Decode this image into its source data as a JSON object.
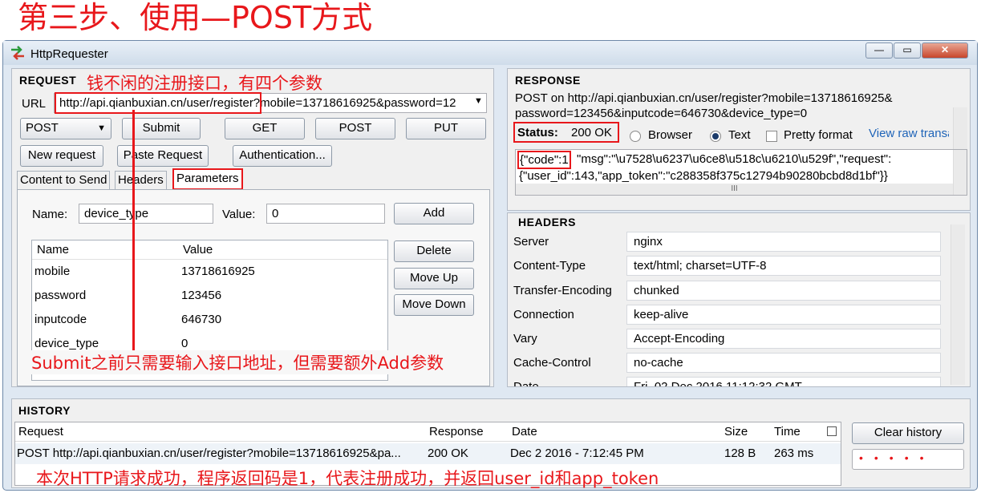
{
  "headline": "第三步、使用—POST方式",
  "window": {
    "title": "HttpRequester",
    "min_label": "—",
    "max_label": "▭",
    "close_label": "✕"
  },
  "request": {
    "section_label": "REQUEST",
    "annotation_top": "钱不闲的注册接口，有四个参数",
    "url_label": "URL",
    "url_value": "http://api.qianbuxian.cn/user/register?mobile=13718616925&password=12",
    "method": "POST",
    "submit_label": "Submit",
    "get_label": "GET",
    "post_label": "POST",
    "put_label": "PUT",
    "new_request_label": "New request",
    "paste_request_label": "Paste Request",
    "authentication_label": "Authentication...",
    "tabs": [
      "Content to Send",
      "Headers",
      "Parameters"
    ],
    "name_label": "Name:",
    "name_value": "device_type",
    "value_label": "Value:",
    "value_value": "0",
    "add_label": "Add",
    "delete_label": "Delete",
    "move_up_label": "Move Up",
    "move_down_label": "Move Down",
    "param_columns": [
      "Name",
      "Value"
    ],
    "params": [
      {
        "name": "mobile",
        "value": "13718616925"
      },
      {
        "name": "password",
        "value": "123456"
      },
      {
        "name": "inputcode",
        "value": "646730"
      },
      {
        "name": "device_type",
        "value": "0"
      }
    ],
    "annotation_bottom": "Submit之前只需要输入接口地址，但需要额外Add参数"
  },
  "response": {
    "section_label": "RESPONSE",
    "request_line1": "POST on http://api.qianbuxian.cn/user/register?mobile=13718616925&",
    "request_line2": "password=123456&inputcode=646730&device_type=0",
    "status_label": "Status:",
    "status_value": "200 OK",
    "browser_label": "Browser",
    "text_label": "Text",
    "pretty_label": "Pretty format",
    "raw_link": "View raw transaction",
    "body_code": "{\"code\":1",
    "body_line1_rest": "\"msg\":\"\\u7528\\u6237\\u6ce8\\u518c\\u6210\\u529f\",\"request\":",
    "body_line2": "{\"user_id\":143,\"app_token\":\"c288358f375c12794b90280bcbd8d1bf\"}}",
    "headers_label": "HEADERS",
    "headers": [
      {
        "key": "Server",
        "value": "nginx"
      },
      {
        "key": "Content-Type",
        "value": "text/html; charset=UTF-8"
      },
      {
        "key": "Transfer-Encoding",
        "value": "chunked"
      },
      {
        "key": "Connection",
        "value": "keep-alive"
      },
      {
        "key": "Vary",
        "value": "Accept-Encoding"
      },
      {
        "key": "Cache-Control",
        "value": "no-cache"
      },
      {
        "key": "Date",
        "value": "Fri, 02 Dec 2016 11:12:32 GMT"
      }
    ]
  },
  "history": {
    "section_label": "HISTORY",
    "columns": [
      "Request",
      "Response",
      "Date",
      "Size",
      "Time"
    ],
    "rows": [
      {
        "request": "POST http://api.qianbuxian.cn/user/register?mobile=13718616925&pa...",
        "response": "200 OK",
        "date": "Dec 2 2016 - 7:12:45 PM",
        "size": "128 B",
        "time": "263 ms"
      }
    ],
    "clear_label": "Clear history",
    "annotation": "本次HTTP请求成功，程序返回码是1，代表注册成功，并返回user_id和app_token"
  }
}
